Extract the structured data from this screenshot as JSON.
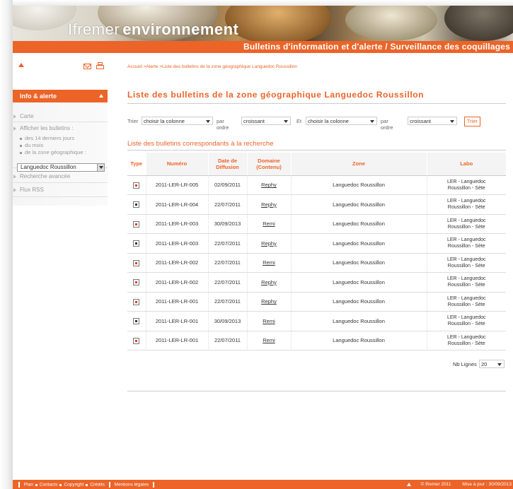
{
  "header": {
    "logo_part1": "Ifremer",
    "logo_part2": "environnement",
    "subtitle": "Bulletins d'information et d'alerte / Surveillance des coquillages"
  },
  "toolbar": {
    "icons": [
      "arrow-up-icon",
      "mail-icon",
      "print-icon"
    ]
  },
  "sidebar": {
    "section_title": "Info & alerte",
    "items": [
      {
        "label": "Carte"
      },
      {
        "label": "Afficher les bulletins :"
      },
      {
        "label": "Recherche avancée"
      },
      {
        "label": "Flux RSS"
      }
    ],
    "subitems": [
      {
        "label": "des 14 derniers jours"
      },
      {
        "label": "du mois"
      },
      {
        "label": "de la zone géographique :"
      }
    ],
    "zone_select_value": "Languedoc Roussillon"
  },
  "breadcrumb": "Accueil >Alerte >Liste des bulletins de la zone géographique Languedoc Roussillon",
  "page_title": "Liste des bulletins de la zone géographique Languedoc Roussillon",
  "sort": {
    "trier_label": "Trier",
    "col1_value": "choisir la colonne",
    "order_label1": "par ordre",
    "order1_value": "croissant",
    "et_label": "Et",
    "col2_value": "choisir la colonne",
    "order_label2": "par ordre",
    "order2_value": "croissant",
    "button_label": "Trier"
  },
  "table": {
    "caption": "Liste des bulletins correspondants à la recherche",
    "headers": {
      "type": "Type",
      "numero": "Numéro",
      "date_l1": "Date de",
      "date_l2": "Diffusion",
      "domaine_l1": "Domaine",
      "domaine_l2": "(Contenu)",
      "zone": "Zone",
      "labo": "Labo"
    },
    "rows": [
      {
        "type": "red",
        "numero": "2011-LER-LR-005",
        "date": "02/09/2011",
        "domaine": "Rephy",
        "zone": "Languedoc Roussillon",
        "labo_l1": "LER - Languedoc",
        "labo_l2": "Roussillon - Sète"
      },
      {
        "type": "dark",
        "numero": "2011-LER-LR-004",
        "date": "22/07/2011",
        "domaine": "Rephy",
        "zone": "Languedoc Roussillon",
        "labo_l1": "LER - Languedoc",
        "labo_l2": "Roussillon - Sète"
      },
      {
        "type": "red",
        "numero": "2011-LER-LR-003",
        "date": "30/09/2013",
        "domaine": "Remi",
        "zone": "Languedoc Roussillon",
        "labo_l1": "LER - Languedoc",
        "labo_l2": "Roussillon - Sète"
      },
      {
        "type": "dark",
        "numero": "2011-LER-LR-003",
        "date": "22/07/2011",
        "domaine": "Rephy",
        "zone": "Languedoc Roussillon",
        "labo_l1": "LER - Languedoc",
        "labo_l2": "Roussillon - Sète"
      },
      {
        "type": "red",
        "numero": "2011-LER-LR-002",
        "date": "22/07/2011",
        "domaine": "Remi",
        "zone": "Languedoc Roussillon",
        "labo_l1": "LER - Languedoc",
        "labo_l2": "Roussillon - Sète"
      },
      {
        "type": "red",
        "numero": "2011-LER-LR-002",
        "date": "22/07/2011",
        "domaine": "Rephy",
        "zone": "Languedoc Roussillon",
        "labo_l1": "LER - Languedoc",
        "labo_l2": "Roussillon - Sète"
      },
      {
        "type": "red",
        "numero": "2011-LER-LR-001",
        "date": "22/07/2011",
        "domaine": "Rephy",
        "zone": "Languedoc Roussillon",
        "labo_l1": "LER - Languedoc",
        "labo_l2": "Roussillon - Sète"
      },
      {
        "type": "dark",
        "numero": "2011-LER-LR-001",
        "date": "30/09/2013",
        "domaine": "Remi",
        "zone": "Languedoc Roussillon",
        "labo_l1": "LER - Languedoc",
        "labo_l2": "Roussillon - Sète"
      },
      {
        "type": "red",
        "numero": "2011-LER-LR-001",
        "date": "22/07/2011",
        "domaine": "Remi",
        "zone": "Languedoc Roussillon",
        "labo_l1": "LER - Languedoc",
        "labo_l2": "Roussillon - Sète"
      }
    ]
  },
  "pagination": {
    "nb_lignes_label": "Nb Lignes",
    "nb_lignes_value": "20"
  },
  "footer": {
    "plan": "Plan",
    "contacts": "Contacts",
    "copyright": "Copyright",
    "credits": "Crédits",
    "mentions": "Mentions légales",
    "copy_owner": "© Ifremer 2011",
    "updated": "Mise à jour : 30/09/2013"
  },
  "colors": {
    "accent": "#ec6428",
    "type_red": "#e83c1e",
    "type_dark": "#333333"
  }
}
